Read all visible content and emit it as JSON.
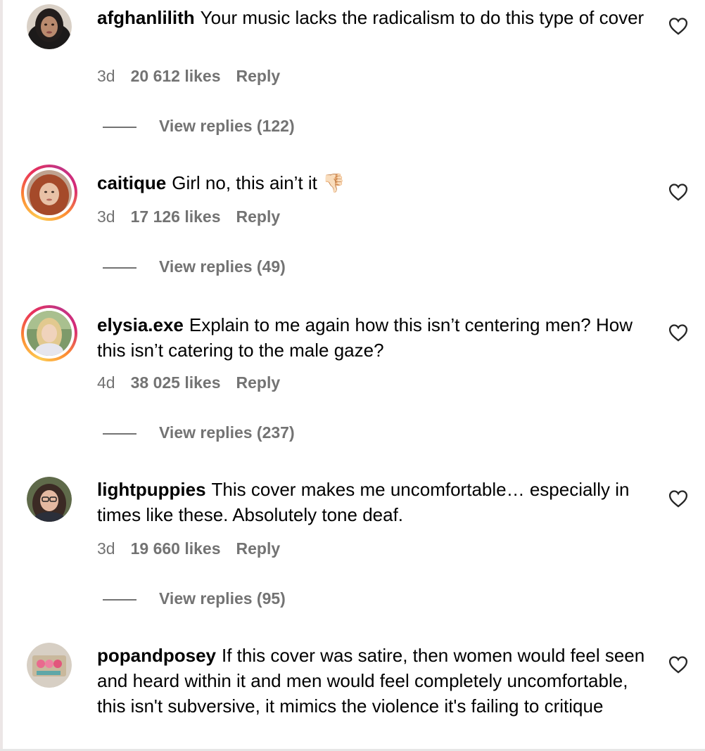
{
  "comments": [
    {
      "username": "afghanlilith",
      "text": "Your music lacks the radicalism to do this type of cover",
      "age": "3d",
      "likes": "20 612 likes",
      "reply": "Reply",
      "view_replies": "View replies (122)",
      "story_ring": false
    },
    {
      "username": "caitique",
      "text": "Girl no, this ain’t it",
      "emoji": "👎🏻",
      "age": "3d",
      "likes": "17 126 likes",
      "reply": "Reply",
      "view_replies": "View replies (49)",
      "story_ring": true
    },
    {
      "username": "elysia.exe",
      "text": "Explain to me again how this isn’t centering men? How this isn’t catering to the male gaze?",
      "age": "4d",
      "likes": "38 025 likes",
      "reply": "Reply",
      "view_replies": "View replies (237)",
      "story_ring": true
    },
    {
      "username": "lightpuppies",
      "text": "This cover makes me uncomfortable… especially in times like these. Absolutely tone deaf.",
      "age": "3d",
      "likes": "19 660 likes",
      "reply": "Reply",
      "view_replies": "View replies (95)",
      "story_ring": false
    },
    {
      "username": "popandposey",
      "text": "If this cover was satire, then women would feel seen and heard within it and men would feel completely uncomfortable, this isn't subversive, it mimics the violence it's failing to critique",
      "age": "",
      "likes": "",
      "reply": "",
      "view_replies": "",
      "story_ring": false
    }
  ],
  "icons": {
    "like": "heart-outline-icon"
  },
  "colors": {
    "meta_text": "#737373",
    "text": "#000000",
    "story_ring": [
      "#fdcb52",
      "#e9305a",
      "#c13584"
    ]
  }
}
